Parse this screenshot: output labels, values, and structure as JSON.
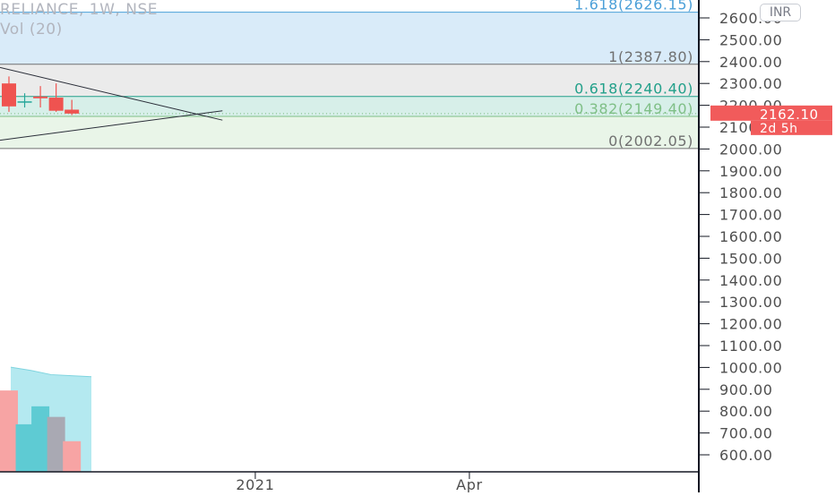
{
  "header": {
    "symbol_line": "RELIANCE, 1W, NSE",
    "volume_line": "Vol (20)"
  },
  "currency_button": "INR",
  "chart_data": {
    "type": "candlestick",
    "y_axis": {
      "range": [
        560,
        2680
      ],
      "ticks": [
        2600,
        2500,
        2400,
        2300,
        2200,
        2100,
        2000,
        1900,
        1800,
        1700,
        1600,
        1500,
        1400,
        1300,
        1200,
        1100,
        1000,
        900,
        800,
        700,
        600
      ],
      "tick_labels": [
        "2600.00",
        "2500.00",
        "2400.00",
        "2300.00",
        "2200.00",
        "2100.00",
        "2000.00",
        "1900.00",
        "1800.00",
        "1700.00",
        "1600.00",
        "1500.00",
        "1400.00",
        "1300.00",
        "1200.00",
        "1100.00",
        "1000.00",
        "900.00",
        "800.00",
        "700.00",
        "600.00"
      ]
    },
    "x_axis": {
      "labels": [
        {
          "label": "2021",
          "t": 0.3653
        },
        {
          "label": "Apr",
          "t": 0.6717
        }
      ]
    },
    "candles": [
      {
        "t": 0.0128,
        "open": 2300,
        "high": 2332,
        "low": 2170,
        "close": 2195
      },
      {
        "t": 0.0353,
        "open": 2218,
        "high": 2255,
        "low": 2190,
        "close": 2218
      },
      {
        "t": 0.0578,
        "open": 2240,
        "high": 2288,
        "low": 2190,
        "close": 2232
      },
      {
        "t": 0.0803,
        "open": 2235,
        "high": 2300,
        "low": 2170,
        "close": 2175
      },
      {
        "t": 0.1028,
        "open": 2180,
        "high": 2225,
        "low": 2155,
        "close": 2162.1
      }
    ],
    "volume_bars": [
      {
        "t": 0.0128,
        "value": 0.77,
        "color": "#f7a4a4"
      },
      {
        "t": 0.0353,
        "value": 0.45,
        "color": "#5ecbd3"
      },
      {
        "t": 0.0578,
        "value": 0.62,
        "color": "#5ecbd3"
      },
      {
        "t": 0.0803,
        "value": 0.52,
        "color": "#a9a9b3"
      },
      {
        "t": 0.1028,
        "value": 0.29,
        "color": "#f7a4a4"
      }
    ],
    "volume_ma": [
      0.99,
      0.96,
      0.92,
      0.91,
      0.9
    ],
    "fibonacci": [
      {
        "label": "1.618(2626.15)",
        "price": 2626.15,
        "color": "#4a9fd8"
      },
      {
        "label": "1(2387.80)",
        "price": 2387.8,
        "color": "#707070"
      },
      {
        "label": "0.618(2240.40)",
        "price": 2240.4,
        "color": "#22a08a"
      },
      {
        "label": "0.382(2149.40)",
        "price": 2149.4,
        "color": "#7fbf86"
      },
      {
        "label": "0(2002.05)",
        "price": 2002.05,
        "color": "#707070"
      }
    ],
    "fib_zone_colors": [
      "#d9ebf9",
      "#ebebeb",
      "#d7efe9",
      "#e9f5e8"
    ],
    "trend_lines": [
      {
        "from": {
          "t": 0.0,
          "price": 2373
        },
        "to": {
          "t": 0.3183,
          "price": 2132
        }
      },
      {
        "from": {
          "t": 0.0,
          "price": 2040
        },
        "to": {
          "t": 0.3183,
          "price": 2175
        }
      }
    ],
    "last_price": {
      "value": "2162.10",
      "price": 2162.1,
      "countdown": "2d 5h",
      "color": "#f15b5b"
    },
    "colors": {
      "axis": "#131722",
      "tick_text": "#4f4f4f",
      "bear": "#ef5350",
      "current_price_line": "#7bbf82"
    }
  }
}
